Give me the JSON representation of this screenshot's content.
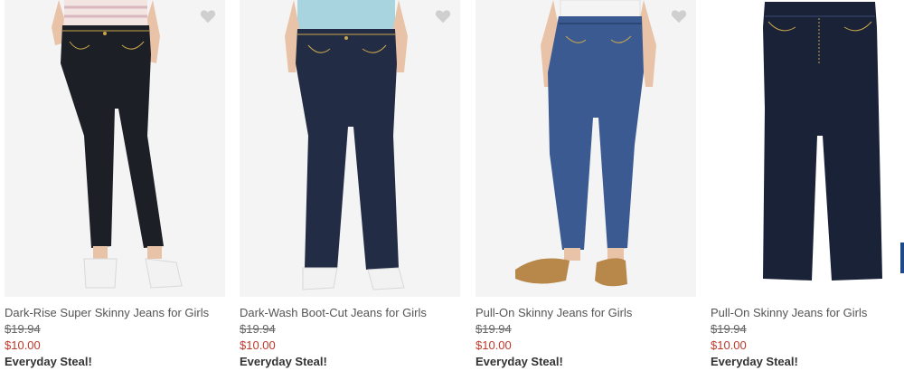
{
  "products": [
    {
      "name": "Dark-Rise Super Skinny Jeans for Girls",
      "was_price": "$19.94",
      "now_price": "$10.00",
      "promo": "Everyday Steal!",
      "favorite_icon": "heart-icon",
      "wash_color": "#1c1f26",
      "has_model": true
    },
    {
      "name": "Dark-Wash Boot-Cut Jeans for Girls",
      "was_price": "$19.94",
      "now_price": "$10.00",
      "promo": "Everyday Steal!",
      "favorite_icon": "heart-icon",
      "wash_color": "#232c45",
      "has_model": true
    },
    {
      "name": "Pull-On Skinny Jeans for Girls",
      "was_price": "$19.94",
      "now_price": "$10.00",
      "promo": "Everyday Steal!",
      "favorite_icon": "heart-icon",
      "wash_color": "#3b5a92",
      "has_model": true
    },
    {
      "name": "Pull-On Skinny Jeans for Girls",
      "was_price": "$19.94",
      "now_price": "$10.00",
      "promo": "Everyday Steal!",
      "favorite_icon": "",
      "wash_color": "#1a2238",
      "has_model": false
    }
  ],
  "colors": {
    "sale_price": "#c0392b",
    "heart": "#cfcfcf",
    "stitching": "#c9a64a"
  }
}
